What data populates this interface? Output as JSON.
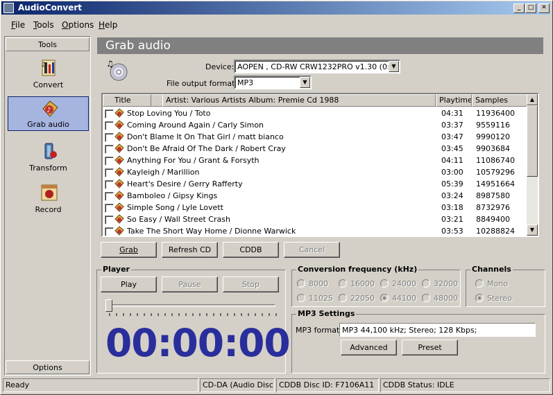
{
  "window": {
    "title": "AudioConvert"
  },
  "menu": [
    {
      "key": "F",
      "rest": "ile"
    },
    {
      "key": "T",
      "rest": "ools"
    },
    {
      "key": "O",
      "rest": "ptions"
    },
    {
      "key": "H",
      "rest": "elp"
    }
  ],
  "sidebar": {
    "header": "Tools",
    "items": [
      {
        "label": "Convert",
        "icon": "convert-icon"
      },
      {
        "label": "Grab audio",
        "icon": "grab-audio-icon",
        "selected": true
      },
      {
        "label": "Transform",
        "icon": "transform-icon"
      },
      {
        "label": "Record",
        "icon": "record-icon"
      }
    ],
    "footer": "Options"
  },
  "panel": {
    "title": "Grab audio",
    "device_label": "Device:",
    "device_value": "AOPEN   , CD-RW CRW1232PRO v1.30 (0:2:0)",
    "format_label": "File output format:",
    "format_value": "MP3"
  },
  "tracks": {
    "headers": {
      "title": "Title",
      "artist": "Artist: Various Artists  Album: Premie Cd 1988",
      "playtime": "Playtime",
      "samples": "Samples"
    },
    "rows": [
      {
        "title": "Stop Loving You / Toto",
        "playtime": "04:31",
        "samples": "11936400"
      },
      {
        "title": "Coming Around Again / Carly Simon",
        "playtime": "03:37",
        "samples": "9559116"
      },
      {
        "title": "Don't Blame It On That Girl / matt bianco",
        "playtime": "03:47",
        "samples": "9990120"
      },
      {
        "title": "Don't Be Afraid Of The Dark / Robert Cray",
        "playtime": "03:45",
        "samples": "9903684"
      },
      {
        "title": "Anything For You / Grant & Forsyth",
        "playtime": "04:11",
        "samples": "11086740"
      },
      {
        "title": "Kayleigh / Marillion",
        "playtime": "03:00",
        "samples": "10579296"
      },
      {
        "title": "Heart's Desire / Gerry Rafferty",
        "playtime": "05:39",
        "samples": "14951664"
      },
      {
        "title": "Bamboleo / Gipsy Kings",
        "playtime": "03:24",
        "samples": "8987580"
      },
      {
        "title": "Simple Song / Lyle Lovett",
        "playtime": "03:18",
        "samples": "8732976"
      },
      {
        "title": "So Easy / Wall Street Crash",
        "playtime": "03:21",
        "samples": "8849400"
      },
      {
        "title": "Take The Short Way Home / Dionne Warwick",
        "playtime": "03:53",
        "samples": "10288824"
      }
    ]
  },
  "actions": {
    "grab": "Grab",
    "refresh": "Refresh CD",
    "cddb": "CDDB",
    "cancel": "Cancel"
  },
  "player": {
    "title": "Player",
    "play": "Play",
    "pause": "Pause",
    "stop": "Stop",
    "time": "00:00:00",
    "position": 0
  },
  "frequency": {
    "title": "Conversion frequency (kHz)",
    "options": [
      "8000",
      "16000",
      "24000",
      "32000",
      "11025",
      "22050",
      "44100",
      "48000"
    ],
    "selected": "44100"
  },
  "channels": {
    "title": "Channels",
    "options": [
      "Mono",
      "Stereo"
    ],
    "selected": "Stereo"
  },
  "mp3": {
    "title": "MP3 Settings",
    "format_label": "MP3 format:",
    "format_value": "MP3 44,100 kHz; Stereo;  128 Kbps;",
    "advanced": "Advanced",
    "preset": "Preset"
  },
  "status": {
    "ready": "Ready",
    "disc": "CD-DA (Audio Disc)",
    "discid": "CDDB Disc ID: F7106A11",
    "cddb": "CDDB Status: IDLE"
  },
  "colors": {
    "timer": "#2a2e9c",
    "title_gradient_start": "#0a246a",
    "title_gradient_end": "#a6caf0",
    "selection": "#a6b4e0"
  }
}
